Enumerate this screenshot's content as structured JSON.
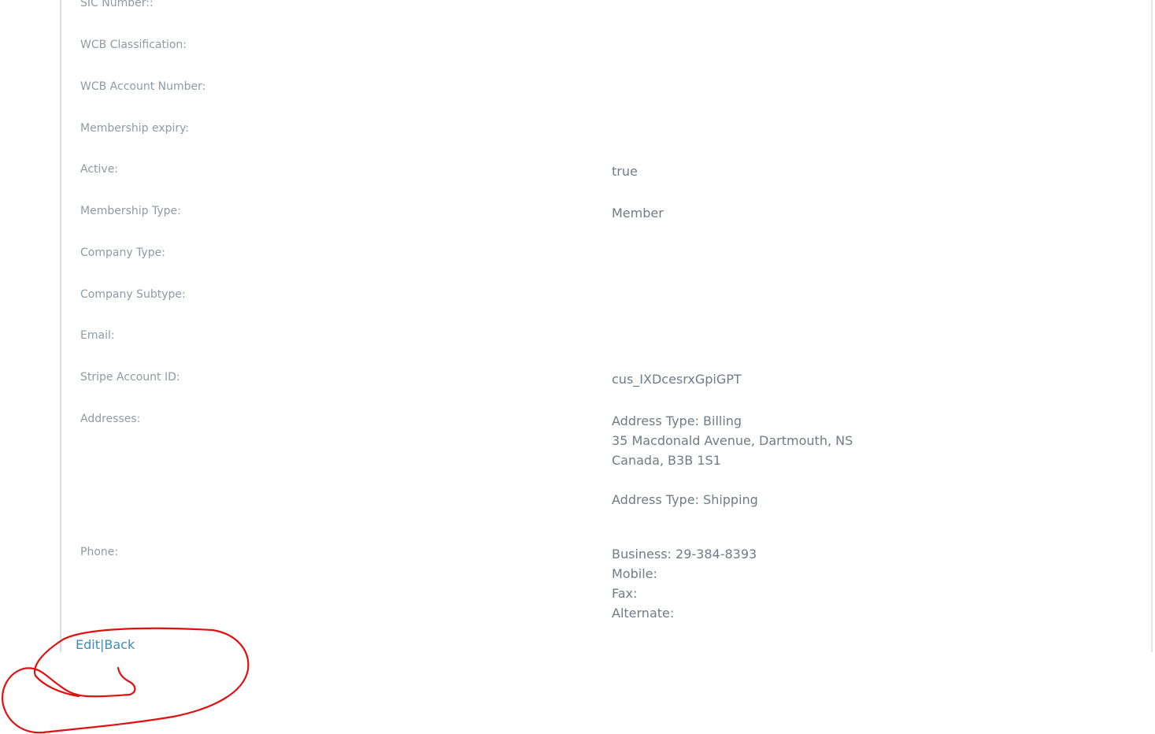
{
  "details": {
    "rows": [
      {
        "label": "SIC Number::",
        "value_lines": []
      },
      {
        "label": "WCB Classification:",
        "value_lines": []
      },
      {
        "label": "WCB Account Number:",
        "value_lines": []
      },
      {
        "label": "Membership expiry:",
        "value_lines": []
      },
      {
        "label": "Active:",
        "value_lines": [
          "true"
        ]
      },
      {
        "label": "Membership Type:",
        "value_lines": [
          "Member"
        ]
      },
      {
        "label": "Company Type:",
        "value_lines": []
      },
      {
        "label": "Company Subtype:",
        "value_lines": []
      },
      {
        "label": "Email:",
        "value_lines": []
      },
      {
        "label": "Stripe Account ID:",
        "value_lines": [
          "cus_IXDcesrxGpiGPT"
        ]
      },
      {
        "label": "Addresses:",
        "value_lines": [
          "Address Type: Billing",
          "35 Macdonald Avenue, Dartmouth, NS",
          "Canada, B3B 1S1",
          "",
          "Address Type: Shipping"
        ]
      },
      {
        "label": "Phone:",
        "value_lines": [
          "Business: 29-384-8393",
          "Mobile:",
          "Fax:",
          "Alternate:"
        ]
      }
    ]
  },
  "actions": {
    "edit_label": "Edit",
    "separator": "|",
    "back_label": "Back"
  },
  "colors": {
    "label": "#8f9aa3",
    "value": "#707b85",
    "link": "#3d8bbd",
    "annotation": "#e01010"
  }
}
